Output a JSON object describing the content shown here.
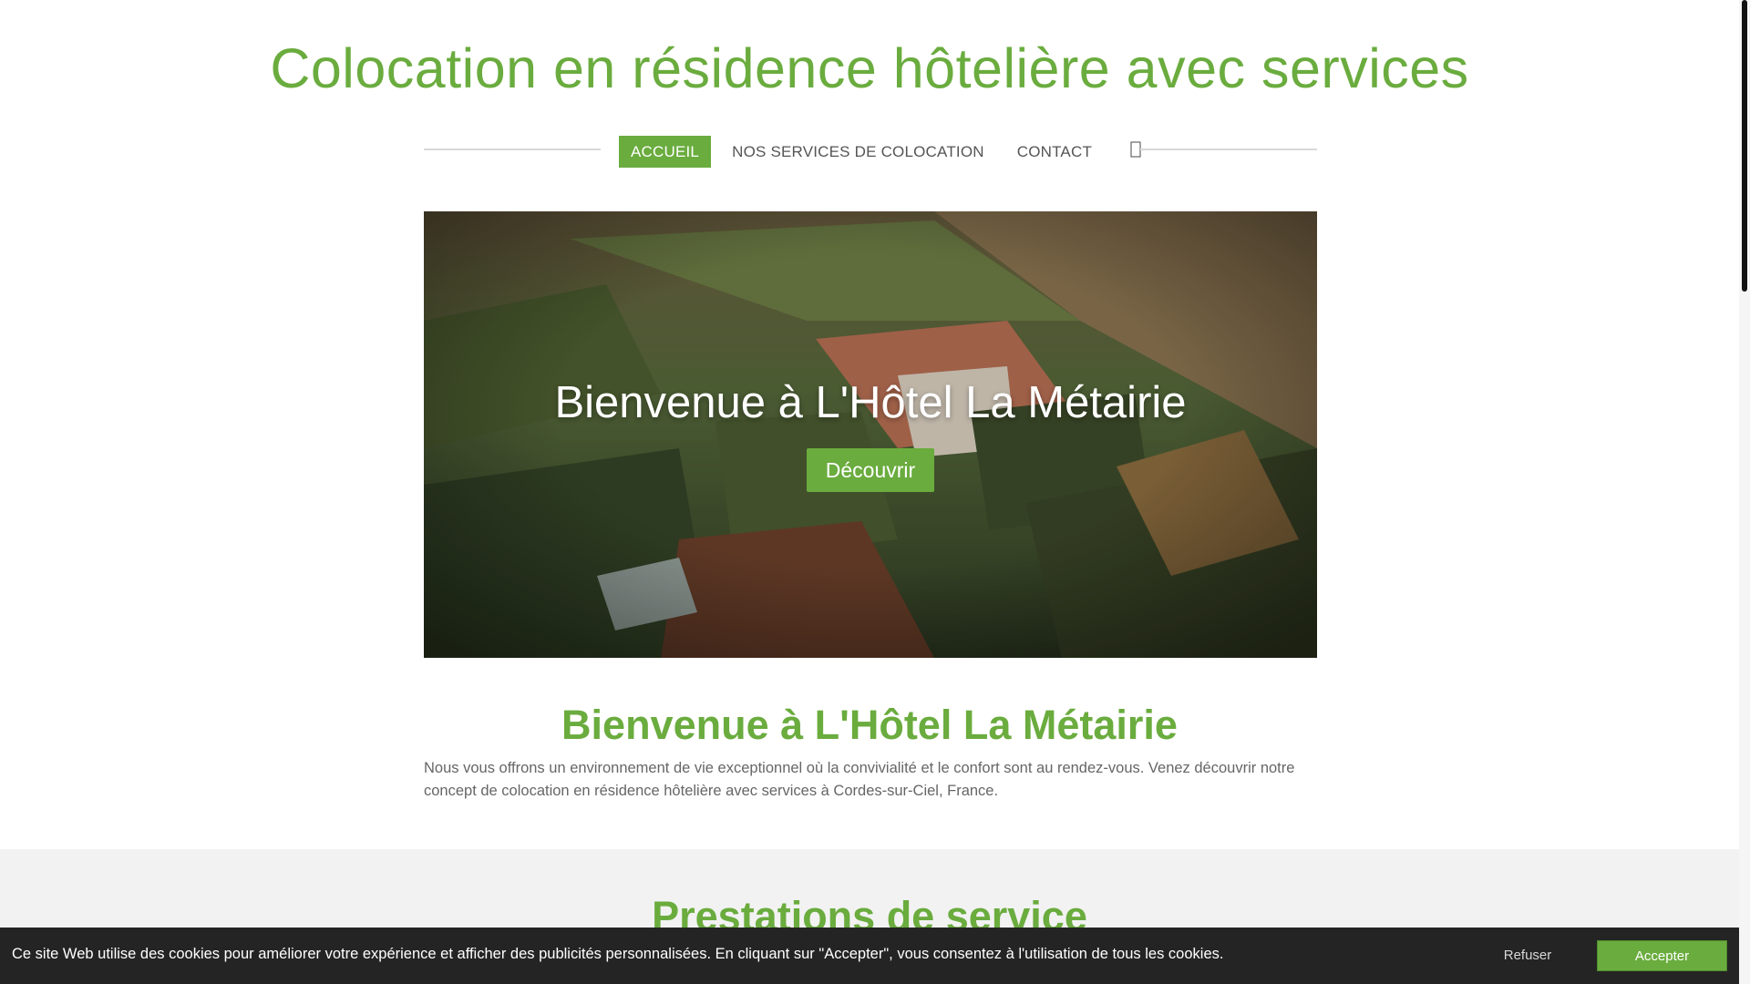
{
  "site": {
    "title": "Colocation en résidence hôtelière avec services"
  },
  "nav": {
    "items": [
      {
        "label": "ACCUEIL",
        "active": true
      },
      {
        "label": "NOS SERVICES DE COLOCATION",
        "active": false
      },
      {
        "label": "CONTACT",
        "active": false
      }
    ],
    "search_icon": "search-icon"
  },
  "hero": {
    "title": "Bienvenue à L'Hôtel La Métairie",
    "button_label": "Découvrir"
  },
  "welcome": {
    "title": "Bienvenue à L'Hôtel La Métairie",
    "text": "Nous vous offrons un environnement de vie exceptionnel où la convivialité et le confort sont au rendez-vous. Venez découvrir notre concept de colocation en résidence hôtelière avec services à Cordes-sur-Ciel, France."
  },
  "services": {
    "title": "Prestations de service"
  },
  "cookie": {
    "text": "Ce site Web utilise des cookies pour améliorer votre expérience et afficher des publicités personnalisées. En cliquant sur \"Accepter\", vous consentez à l'utilisation de tous les cookies.",
    "refuse_label": "Refuser",
    "accept_label": "Accepter"
  },
  "colors": {
    "accent": "#6aac3e",
    "cookie_bg": "#242424",
    "band_bg": "#f2f2f2"
  }
}
